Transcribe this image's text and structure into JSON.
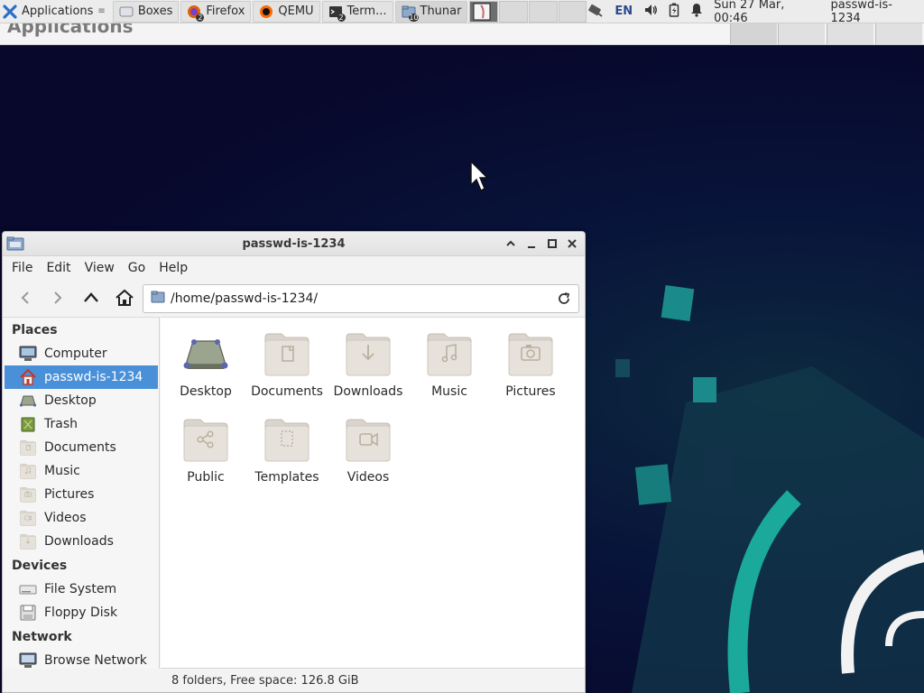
{
  "panel": {
    "applications_label": "Applications",
    "tasks": [
      {
        "label": "Boxes",
        "icon": "boxes-icon",
        "badge": ""
      },
      {
        "label": "Firefox",
        "icon": "firefox-icon",
        "badge": "2"
      },
      {
        "label": "QEMU",
        "icon": "qemu-icon",
        "badge": ""
      },
      {
        "label": "Term...",
        "icon": "terminal-icon",
        "badge": "2"
      },
      {
        "label": "Thunar",
        "icon": "folder-icon",
        "badge": "10"
      }
    ],
    "language": "EN",
    "clock": "Sun 27 Mar, 00:46",
    "username": "passwd-is-1234"
  },
  "window": {
    "title": "passwd-is-1234",
    "menu": [
      "File",
      "Edit",
      "View",
      "Go",
      "Help"
    ],
    "location": "/home/passwd-is-1234/",
    "sidebar": {
      "places_header": "Places",
      "places": [
        {
          "label": "Computer",
          "icon": "computer-icon"
        },
        {
          "label": "passwd-is-1234",
          "icon": "home-icon",
          "selected": true
        },
        {
          "label": "Desktop",
          "icon": "desktop-icon"
        },
        {
          "label": "Trash",
          "icon": "trash-icon"
        },
        {
          "label": "Documents",
          "icon": "documents-folder-icon"
        },
        {
          "label": "Music",
          "icon": "music-folder-icon"
        },
        {
          "label": "Pictures",
          "icon": "pictures-folder-icon"
        },
        {
          "label": "Videos",
          "icon": "videos-folder-icon"
        },
        {
          "label": "Downloads",
          "icon": "downloads-folder-icon"
        }
      ],
      "devices_header": "Devices",
      "devices": [
        {
          "label": "File System",
          "icon": "drive-icon"
        },
        {
          "label": "Floppy Disk",
          "icon": "floppy-icon"
        }
      ],
      "network_header": "Network",
      "network": [
        {
          "label": "Browse Network",
          "icon": "network-icon"
        }
      ]
    },
    "files": [
      {
        "label": "Desktop",
        "icon": "desktop-icon"
      },
      {
        "label": "Documents",
        "icon": "documents-folder-icon"
      },
      {
        "label": "Downloads",
        "icon": "downloads-folder-icon"
      },
      {
        "label": "Music",
        "icon": "music-folder-icon"
      },
      {
        "label": "Pictures",
        "icon": "pictures-folder-icon"
      },
      {
        "label": "Public",
        "icon": "public-folder-icon"
      },
      {
        "label": "Templates",
        "icon": "templates-folder-icon"
      },
      {
        "label": "Videos",
        "icon": "videos-folder-icon"
      }
    ],
    "status": "8 folders, Free space: 126.8 GiB"
  },
  "colors": {
    "selection": "#4a90d9",
    "desktop_bg": "#07082c",
    "accent_teal": "#1aa99a"
  }
}
